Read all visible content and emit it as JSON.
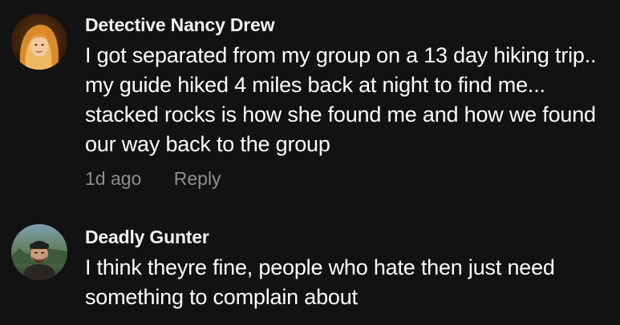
{
  "comments": [
    {
      "username": "Detective Nancy Drew",
      "text": "I got separated from my group on a 13 day hiking trip.. my guide hiked 4 miles back at night to find me... stacked rocks is how she found me and how we found our way back to the group",
      "timestamp": "1d ago",
      "reply_label": "Reply"
    },
    {
      "username": "Deadly Gunter",
      "text": "I think theyre fine, people who hate then just need something to complain about"
    }
  ]
}
